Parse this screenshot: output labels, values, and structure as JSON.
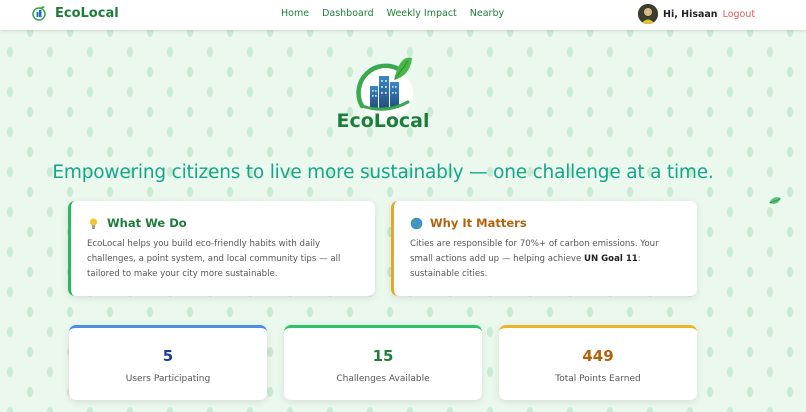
{
  "brand": {
    "name": "EcoLocal"
  },
  "nav": {
    "links": [
      "Home",
      "Dashboard",
      "Weekly Impact",
      "Nearby"
    ]
  },
  "user": {
    "greeting": "Hi, Hisaan",
    "logout": "Logout"
  },
  "hero": {
    "name": "EcoLocal",
    "tagline": "Empowering citizens to live more sustainably — one challenge at a time."
  },
  "info": {
    "what": {
      "title": "What We Do",
      "body": "EcoLocal helps you build eco-friendly habits with daily challenges, a point system, and local community tips — all tailored to make your city more sustainable."
    },
    "why": {
      "title": "Why It Matters",
      "body_pre": "Cities are responsible for 70%+ of carbon emissions. Your small actions add up — helping achieve ",
      "body_bold": "UN Goal 11",
      "body_post": ": sustainable cities."
    }
  },
  "stats": [
    {
      "value": "5",
      "label": "Users Participating"
    },
    {
      "value": "15",
      "label": "Challenges Available"
    },
    {
      "value": "449",
      "label": "Total Points Earned"
    }
  ],
  "colors": {
    "brand_green": "#1e7d3a",
    "tagline_teal": "#17a58a",
    "logout_red": "#e05a5a",
    "users_blue": "#4a90e2",
    "challenges_green": "#2fc26a",
    "points_gold": "#e8b629"
  },
  "icons": {
    "what": "lightbulb-icon",
    "why": "globe-icon"
  }
}
